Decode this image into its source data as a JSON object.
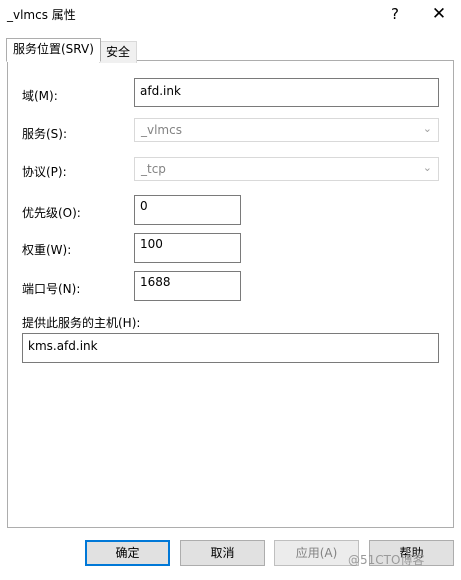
{
  "window": {
    "title": "_vlmcs 属性",
    "help_glyph": "?",
    "close_glyph": "✕"
  },
  "tabs": [
    {
      "label": "服务位置(SRV)",
      "active": true
    },
    {
      "label": "安全",
      "active": false
    }
  ],
  "form": {
    "domain_label": "域(M):",
    "domain_value": "afd.ink",
    "service_label": "服务(S):",
    "service_value": "_vlmcs",
    "protocol_label": "协议(P):",
    "protocol_value": "_tcp",
    "priority_label": "优先级(O):",
    "priority_value": "0",
    "weight_label": "权重(W):",
    "weight_value": "100",
    "port_label": "端口号(N):",
    "port_value": "1688",
    "host_label": "提供此服务的主机(H):",
    "host_value": "kms.afd.ink"
  },
  "buttons": {
    "ok": "确定",
    "cancel": "取消",
    "apply": "应用(A)",
    "help": "帮助"
  },
  "watermark": "@51CTO博客",
  "colors": {
    "focus_border": "#0078d7",
    "disabled_text": "#838383"
  }
}
